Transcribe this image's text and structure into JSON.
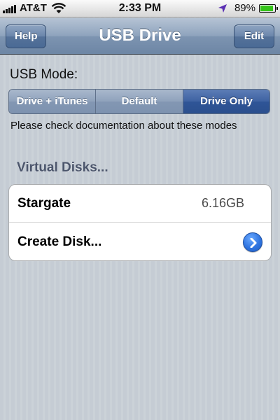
{
  "status_bar": {
    "carrier": "AT&T",
    "time": "2:33 PM",
    "battery_percent": "89%",
    "battery_level": 0.89,
    "battery_color": "#35c41a"
  },
  "nav": {
    "title": "USB Drive",
    "left_button": "Help",
    "right_button": "Edit"
  },
  "usb_mode": {
    "label": "USB Mode:",
    "options": [
      "Drive + iTunes",
      "Default",
      "Drive Only"
    ],
    "selected": "Drive Only",
    "note": "Please check documentation about these modes"
  },
  "virtual_disks": {
    "title": "Virtual Disks...",
    "rows": [
      {
        "label": "Stargate",
        "value": "6.16GB"
      },
      {
        "label": "Create Disk...",
        "value": ""
      }
    ]
  },
  "colors": {
    "segment_selected": "#2f5597",
    "disclosure_blue": "#2f74e0"
  },
  "icons": [
    "signal-icon",
    "wifi-icon",
    "location-arrow-icon",
    "battery-icon",
    "disclosure-chevron-icon"
  ]
}
